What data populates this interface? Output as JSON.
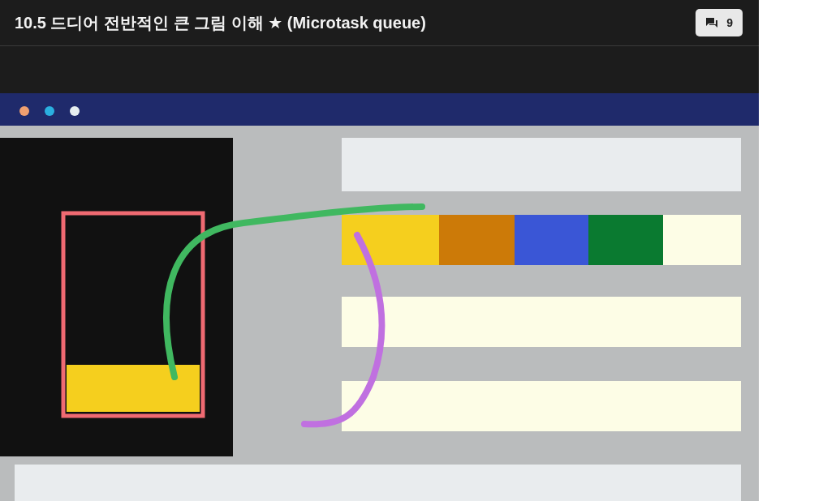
{
  "header": {
    "title": "10.5 드디어 전반적인 큰 그림 이해 ★ (Microtask queue)",
    "comments": {
      "count": "9"
    }
  }
}
